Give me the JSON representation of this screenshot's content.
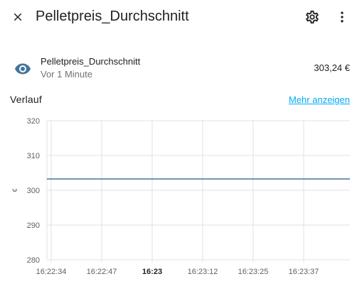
{
  "header": {
    "title": "Pelletpreis_Durchschnitt",
    "close_icon": "close-icon",
    "settings_icon": "gear-icon",
    "more_icon": "more-vert-icon"
  },
  "entity": {
    "name": "Pelletpreis_Durchschnitt",
    "last_changed": "Vor 1 Minute",
    "value": "303,24 €",
    "icon": "eye-icon",
    "icon_color": "#44739e"
  },
  "history": {
    "title": "Verlauf",
    "more_link": "Mehr anzeigen"
  },
  "chart_data": {
    "type": "line",
    "ylabel": "€",
    "ylim": [
      280,
      320
    ],
    "yticks": [
      280,
      290,
      300,
      310,
      320
    ],
    "x_ticks": [
      "16:22:34",
      "16:22:47",
      "16:23",
      "16:23:12",
      "16:23:25",
      "16:23:37"
    ],
    "x_tick_bold": [
      false,
      false,
      true,
      false,
      false,
      false
    ],
    "series": [
      {
        "color": "#44739e",
        "x": [
          "16:22:34",
          "16:23:40"
        ],
        "values": [
          303.24,
          303.24
        ]
      }
    ],
    "grid": true
  }
}
